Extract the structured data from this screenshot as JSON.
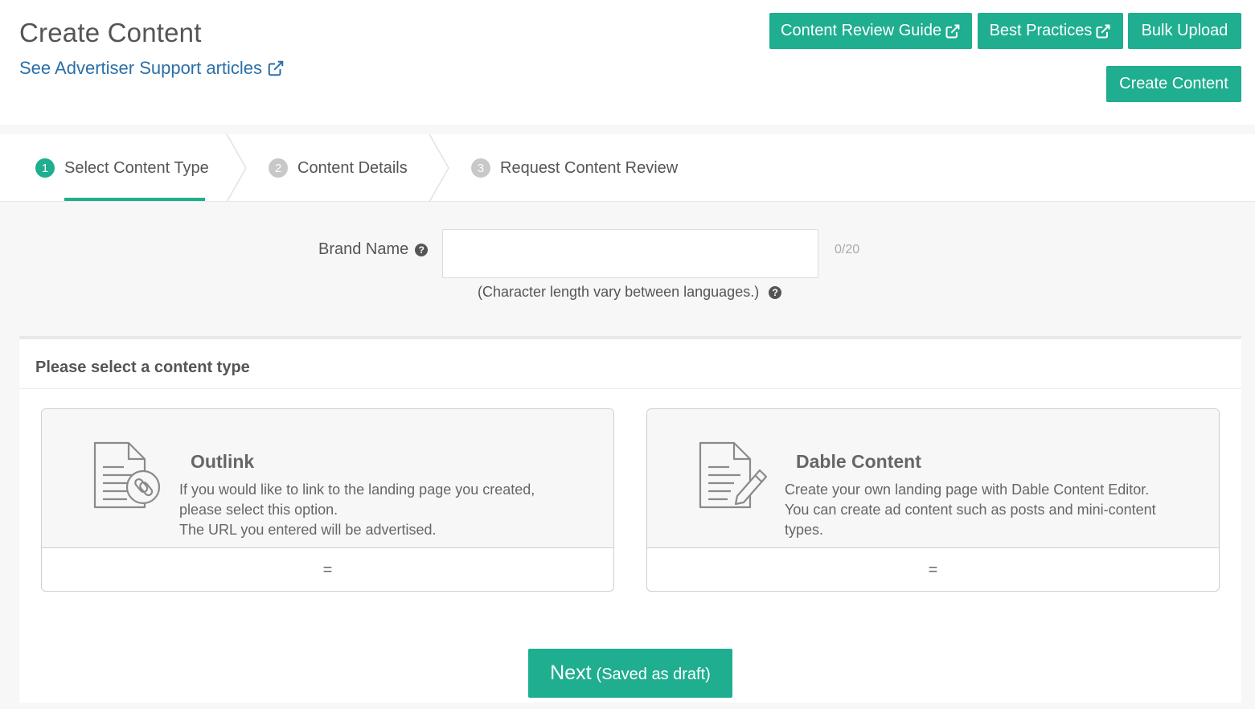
{
  "header": {
    "title": "Create Content",
    "support_link": "See Advertiser Support articles",
    "buttons": {
      "content_review_guide": "Content Review Guide",
      "best_practices": "Best Practices",
      "bulk_upload": "Bulk Upload",
      "create_content": "Create Content"
    }
  },
  "steps": [
    {
      "number": "1",
      "label": "Select Content Type",
      "active": true
    },
    {
      "number": "2",
      "label": "Content Details",
      "active": false
    },
    {
      "number": "3",
      "label": "Request Content Review",
      "active": false
    }
  ],
  "brand": {
    "label": "Brand Name",
    "value": "",
    "placeholder": "",
    "count": "0/20",
    "note": "(Character length vary between languages.)"
  },
  "content_type": {
    "heading": "Please select a content type",
    "cards": [
      {
        "title": "Outlink",
        "desc_lines": [
          "If you would like to link to the landing page you created,",
          "please select this option.",
          "The URL you entered will be advertised."
        ],
        "footer": "="
      },
      {
        "title": "Dable Content",
        "desc_lines": [
          "Create your own landing page with Dable Content Editor.",
          "You can create ad content such as posts and mini-content",
          "types."
        ],
        "footer": "="
      }
    ]
  },
  "next_button": {
    "main": "Next",
    "sub": "(Saved as draft)"
  },
  "colors": {
    "accent": "#1fae8f",
    "link": "#2a6fa8"
  }
}
